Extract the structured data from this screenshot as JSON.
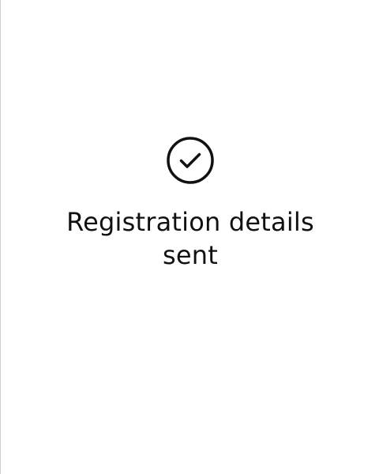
{
  "confirmation": {
    "icon": "check-circle-icon",
    "message": "Registration details sent"
  }
}
